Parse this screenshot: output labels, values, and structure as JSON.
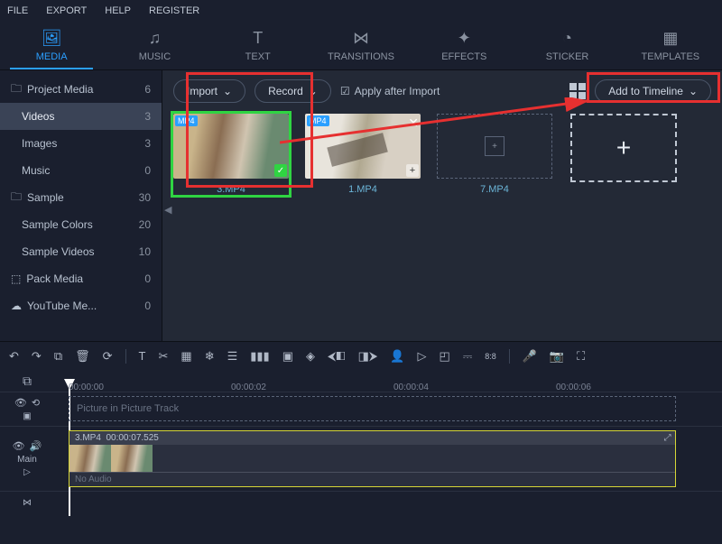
{
  "menu": {
    "file": "FILE",
    "export": "EXPORT",
    "help": "HELP",
    "register": "REGISTER"
  },
  "tabs": {
    "media": "MEDIA",
    "music": "MUSIC",
    "text": "TEXT",
    "transitions": "TRANSITIONS",
    "effects": "EFFECTS",
    "sticker": "STICKER",
    "templates": "TEMPLATES"
  },
  "sidebar": {
    "project_media": {
      "label": "Project Media",
      "count": "6"
    },
    "videos": {
      "label": "Videos",
      "count": "3"
    },
    "images": {
      "label": "Images",
      "count": "3"
    },
    "music": {
      "label": "Music",
      "count": "0"
    },
    "sample": {
      "label": "Sample",
      "count": "30"
    },
    "sample_colors": {
      "label": "Sample Colors",
      "count": "20"
    },
    "sample_videos": {
      "label": "Sample Videos",
      "count": "10"
    },
    "pack_media": {
      "label": "Pack Media",
      "count": "0"
    },
    "youtube": {
      "label": "YouTube Me...",
      "count": "0"
    }
  },
  "toolbar": {
    "import": "Import",
    "record": "Record",
    "apply_after": "Apply after Import",
    "add_timeline": "Add to Timeline"
  },
  "thumbs": {
    "t1": "3.MP4",
    "t2": "1.MP4",
    "t3": "7.MP4",
    "badge": "MP4",
    "plus": "+"
  },
  "timeline": {
    "ruler": {
      "t0": "00:00:00",
      "t2": "00:00:02",
      "t4": "00:00:04",
      "t6": "00:00:06"
    },
    "pip_label": "Picture in Picture Track",
    "main_label": "Main",
    "clip": {
      "name": "3.MP4",
      "duration": "00:00:07.525",
      "no_audio": "No Audio"
    }
  },
  "colors": {
    "accent": "#2b9fff",
    "highlight": "#e63030",
    "select_green": "#2fd442",
    "clip_border": "#d6d637"
  }
}
